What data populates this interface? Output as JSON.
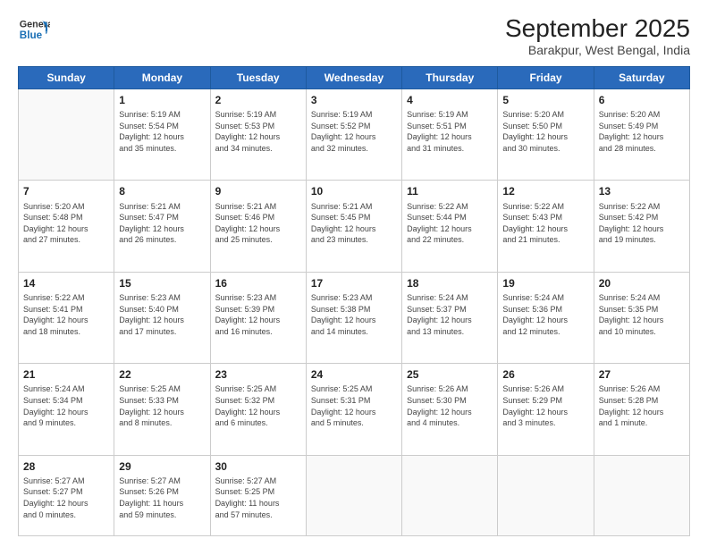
{
  "logo": {
    "line1": "General",
    "line2": "Blue"
  },
  "title": "September 2025",
  "subtitle": "Barakpur, West Bengal, India",
  "weekdays": [
    "Sunday",
    "Monday",
    "Tuesday",
    "Wednesday",
    "Thursday",
    "Friday",
    "Saturday"
  ],
  "weeks": [
    [
      {
        "day": "",
        "info": ""
      },
      {
        "day": "1",
        "info": "Sunrise: 5:19 AM\nSunset: 5:54 PM\nDaylight: 12 hours\nand 35 minutes."
      },
      {
        "day": "2",
        "info": "Sunrise: 5:19 AM\nSunset: 5:53 PM\nDaylight: 12 hours\nand 34 minutes."
      },
      {
        "day": "3",
        "info": "Sunrise: 5:19 AM\nSunset: 5:52 PM\nDaylight: 12 hours\nand 32 minutes."
      },
      {
        "day": "4",
        "info": "Sunrise: 5:19 AM\nSunset: 5:51 PM\nDaylight: 12 hours\nand 31 minutes."
      },
      {
        "day": "5",
        "info": "Sunrise: 5:20 AM\nSunset: 5:50 PM\nDaylight: 12 hours\nand 30 minutes."
      },
      {
        "day": "6",
        "info": "Sunrise: 5:20 AM\nSunset: 5:49 PM\nDaylight: 12 hours\nand 28 minutes."
      }
    ],
    [
      {
        "day": "7",
        "info": "Sunrise: 5:20 AM\nSunset: 5:48 PM\nDaylight: 12 hours\nand 27 minutes."
      },
      {
        "day": "8",
        "info": "Sunrise: 5:21 AM\nSunset: 5:47 PM\nDaylight: 12 hours\nand 26 minutes."
      },
      {
        "day": "9",
        "info": "Sunrise: 5:21 AM\nSunset: 5:46 PM\nDaylight: 12 hours\nand 25 minutes."
      },
      {
        "day": "10",
        "info": "Sunrise: 5:21 AM\nSunset: 5:45 PM\nDaylight: 12 hours\nand 23 minutes."
      },
      {
        "day": "11",
        "info": "Sunrise: 5:22 AM\nSunset: 5:44 PM\nDaylight: 12 hours\nand 22 minutes."
      },
      {
        "day": "12",
        "info": "Sunrise: 5:22 AM\nSunset: 5:43 PM\nDaylight: 12 hours\nand 21 minutes."
      },
      {
        "day": "13",
        "info": "Sunrise: 5:22 AM\nSunset: 5:42 PM\nDaylight: 12 hours\nand 19 minutes."
      }
    ],
    [
      {
        "day": "14",
        "info": "Sunrise: 5:22 AM\nSunset: 5:41 PM\nDaylight: 12 hours\nand 18 minutes."
      },
      {
        "day": "15",
        "info": "Sunrise: 5:23 AM\nSunset: 5:40 PM\nDaylight: 12 hours\nand 17 minutes."
      },
      {
        "day": "16",
        "info": "Sunrise: 5:23 AM\nSunset: 5:39 PM\nDaylight: 12 hours\nand 16 minutes."
      },
      {
        "day": "17",
        "info": "Sunrise: 5:23 AM\nSunset: 5:38 PM\nDaylight: 12 hours\nand 14 minutes."
      },
      {
        "day": "18",
        "info": "Sunrise: 5:24 AM\nSunset: 5:37 PM\nDaylight: 12 hours\nand 13 minutes."
      },
      {
        "day": "19",
        "info": "Sunrise: 5:24 AM\nSunset: 5:36 PM\nDaylight: 12 hours\nand 12 minutes."
      },
      {
        "day": "20",
        "info": "Sunrise: 5:24 AM\nSunset: 5:35 PM\nDaylight: 12 hours\nand 10 minutes."
      }
    ],
    [
      {
        "day": "21",
        "info": "Sunrise: 5:24 AM\nSunset: 5:34 PM\nDaylight: 12 hours\nand 9 minutes."
      },
      {
        "day": "22",
        "info": "Sunrise: 5:25 AM\nSunset: 5:33 PM\nDaylight: 12 hours\nand 8 minutes."
      },
      {
        "day": "23",
        "info": "Sunrise: 5:25 AM\nSunset: 5:32 PM\nDaylight: 12 hours\nand 6 minutes."
      },
      {
        "day": "24",
        "info": "Sunrise: 5:25 AM\nSunset: 5:31 PM\nDaylight: 12 hours\nand 5 minutes."
      },
      {
        "day": "25",
        "info": "Sunrise: 5:26 AM\nSunset: 5:30 PM\nDaylight: 12 hours\nand 4 minutes."
      },
      {
        "day": "26",
        "info": "Sunrise: 5:26 AM\nSunset: 5:29 PM\nDaylight: 12 hours\nand 3 minutes."
      },
      {
        "day": "27",
        "info": "Sunrise: 5:26 AM\nSunset: 5:28 PM\nDaylight: 12 hours\nand 1 minute."
      }
    ],
    [
      {
        "day": "28",
        "info": "Sunrise: 5:27 AM\nSunset: 5:27 PM\nDaylight: 12 hours\nand 0 minutes."
      },
      {
        "day": "29",
        "info": "Sunrise: 5:27 AM\nSunset: 5:26 PM\nDaylight: 11 hours\nand 59 minutes."
      },
      {
        "day": "30",
        "info": "Sunrise: 5:27 AM\nSunset: 5:25 PM\nDaylight: 11 hours\nand 57 minutes."
      },
      {
        "day": "",
        "info": ""
      },
      {
        "day": "",
        "info": ""
      },
      {
        "day": "",
        "info": ""
      },
      {
        "day": "",
        "info": ""
      }
    ]
  ]
}
